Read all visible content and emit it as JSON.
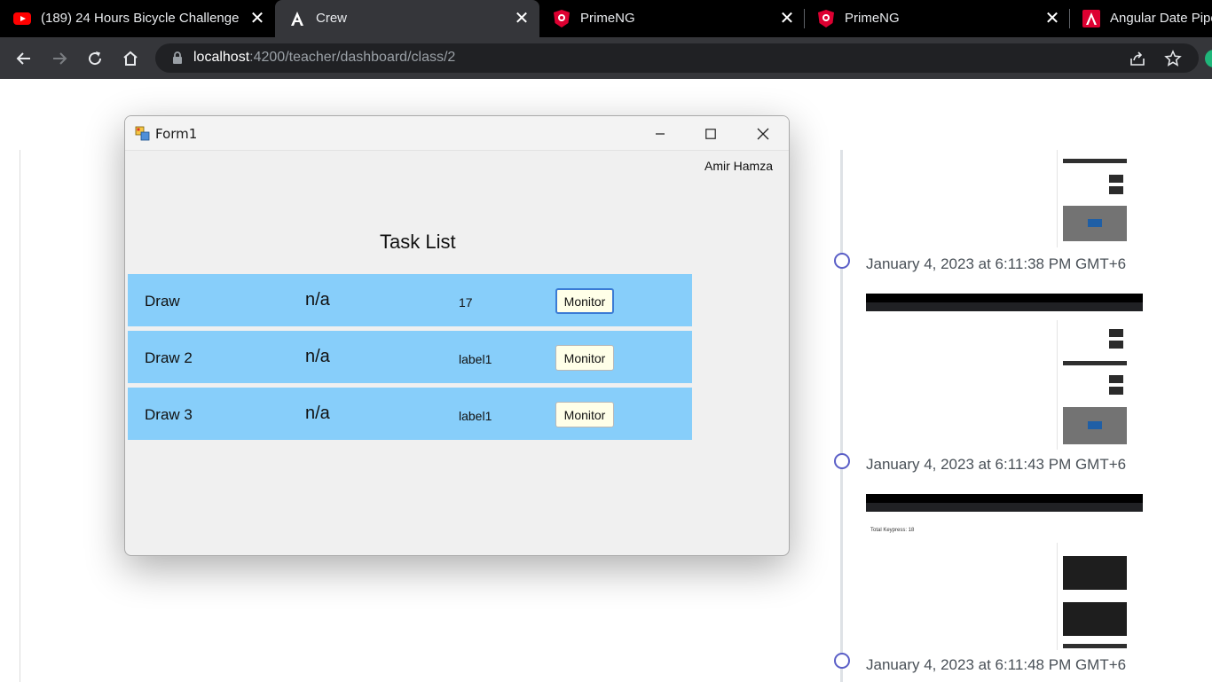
{
  "browser": {
    "tabs": [
      {
        "title": "(189) 24 Hours Bicycle Challenge",
        "icon": "youtube-icon",
        "active": false
      },
      {
        "title": "Crew",
        "icon": "angular-icon",
        "active": true
      },
      {
        "title": "PrimeNG",
        "icon": "primeng-shield-icon",
        "active": false
      },
      {
        "title": "PrimeNG",
        "icon": "primeng-shield-icon",
        "active": false
      },
      {
        "title": "Angular Date Pipe",
        "icon": "angular-red-icon",
        "active": false
      }
    ],
    "close_glyph": "✕",
    "url_host": "localhost",
    "url_path": ":4200/teacher/dashboard/class/2"
  },
  "form": {
    "title": "Form1",
    "user_name": "Amir Hamza",
    "heading": "Task List",
    "tasks": [
      {
        "name": "Draw",
        "status": "n/a",
        "count": "17",
        "button": "Monitor"
      },
      {
        "name": "Draw 2",
        "status": "n/a",
        "count": "label1",
        "button": "Monitor"
      },
      {
        "name": "Draw 3",
        "status": "n/a",
        "count": "label1",
        "button": "Monitor"
      }
    ]
  },
  "timeline": {
    "entries": [
      {
        "time": "January 4, 2023 at 6:11:38 PM GMT+6"
      },
      {
        "time": "January 4, 2023 at 6:11:43 PM GMT+6"
      },
      {
        "time": "January 4, 2023 at 6:11:48 PM GMT+6"
      }
    ],
    "thumbnail_text": "Total Keypress: 18"
  },
  "colors": {
    "task_row": "#87cefa",
    "monitor_button": "#ffffe8",
    "timeline_marker": "#5b5fc7",
    "tab_bar": "#000000",
    "toolbar": "#35363a"
  }
}
